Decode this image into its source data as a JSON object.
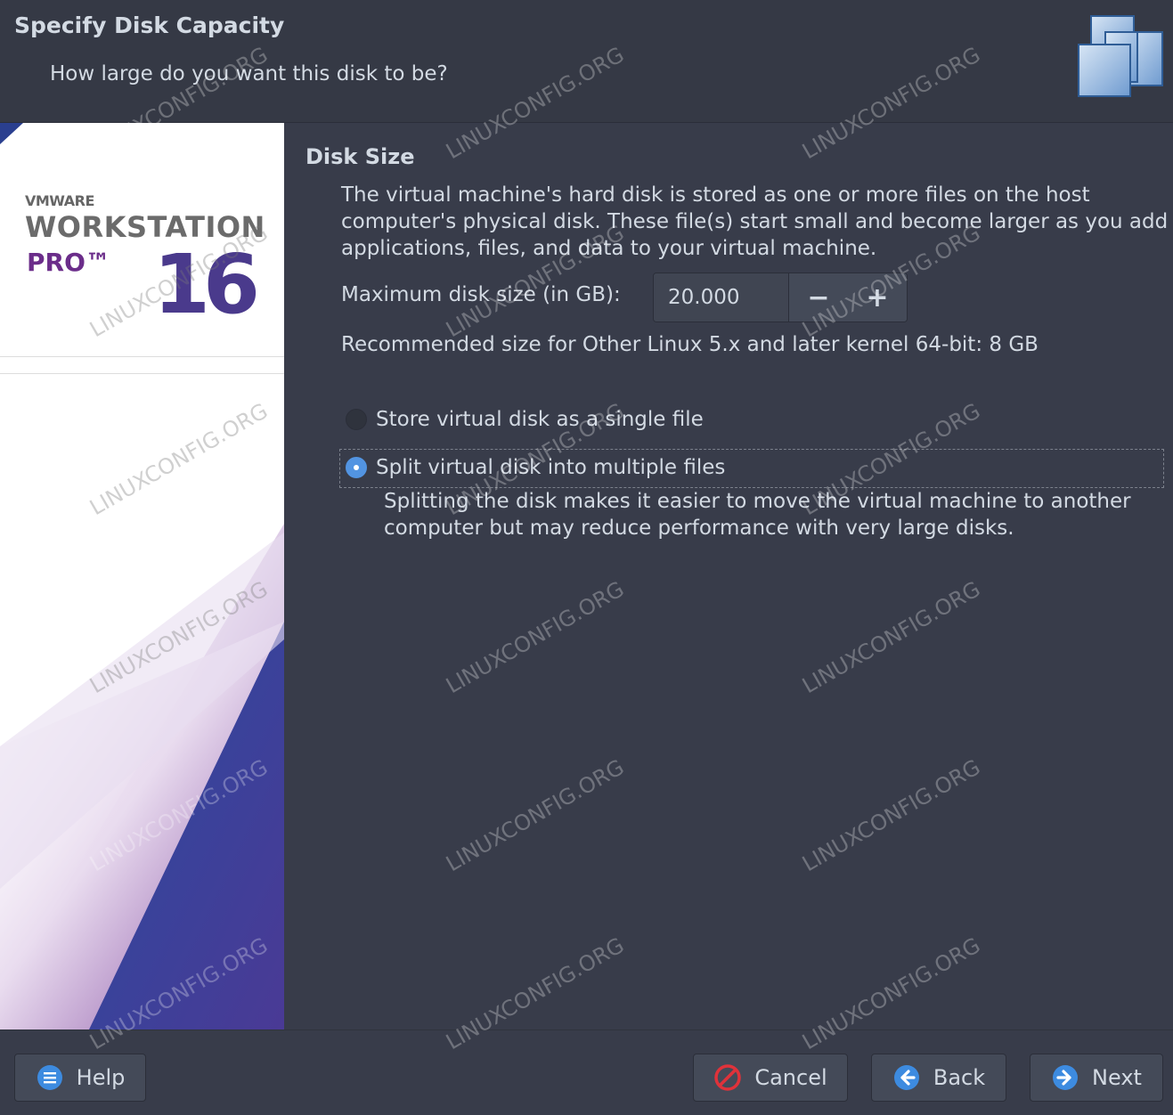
{
  "header": {
    "title": "Specify Disk Capacity",
    "subtitle": "How large do you want this disk to be?",
    "logo_icon": "vmware-stacked-windows-icon"
  },
  "sidebar": {
    "brand_small": "VMWARE",
    "brand_main": "WORKSTATION",
    "brand_pro": "PRO™",
    "brand_version": "16"
  },
  "disk_size": {
    "title": "Disk Size",
    "description": "The virtual machine's hard disk is stored as one or more files on the host computer's physical disk. These file(s) start small and become larger as you add applications, files, and data to your virtual machine.",
    "max_label": "Maximum disk size (in GB):",
    "max_value": "20.000",
    "decrement_label": "−",
    "increment_label": "+",
    "recommended": "Recommended size for Other Linux 5.x and later kernel 64-bit: 8 GB"
  },
  "options": {
    "single_label": "Store virtual disk as a single file",
    "single_checked": false,
    "split_label": "Split virtual disk into multiple files",
    "split_checked": true,
    "split_description": "Splitting the disk makes it easier to move the virtual machine to another computer but may reduce performance with very large disks."
  },
  "footer": {
    "help_label": "Help",
    "cancel_label": "Cancel",
    "back_label": "Back",
    "next_label": "Next"
  },
  "watermark": {
    "text": "LINUXCONFIG.ORG"
  },
  "colors": {
    "background": "#383c4a",
    "header": "#353945",
    "accent": "#5294e2",
    "cancel_red": "#e0323a",
    "text": "#d3dae3"
  }
}
